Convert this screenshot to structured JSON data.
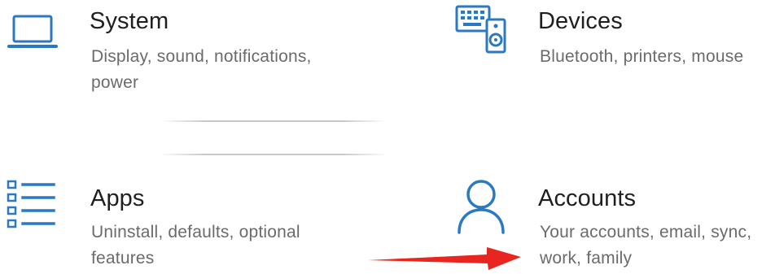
{
  "tiles": {
    "system": {
      "title": "System",
      "description": "Display, sound, notifications, power",
      "icon": "laptop-icon"
    },
    "devices": {
      "title": "Devices",
      "description": "Bluetooth, printers, mouse",
      "icon": "keyboard-speaker-icon"
    },
    "apps": {
      "title": "Apps",
      "description": "Uninstall, defaults, optional features",
      "icon": "app-list-icon"
    },
    "accounts": {
      "title": "Accounts",
      "description": "Your accounts, email, sync, work, family",
      "icon": "person-icon"
    }
  },
  "colors": {
    "icon_accent": "#2b79c2",
    "title_text": "#1f1f1f",
    "description_text": "#6b6b6b",
    "annotation_arrow": "#e8251f"
  }
}
